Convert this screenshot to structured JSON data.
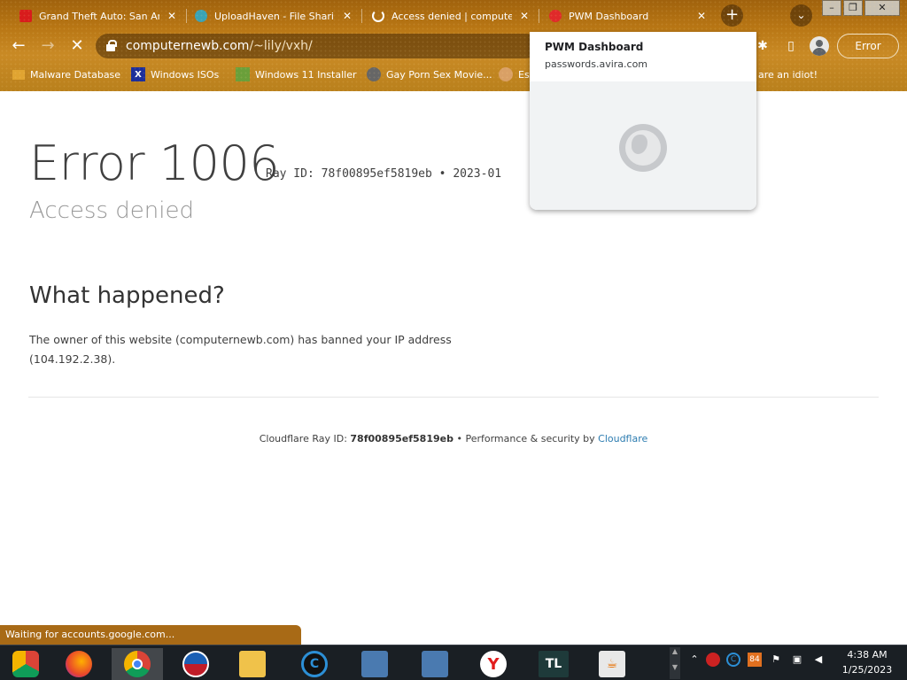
{
  "tabs": [
    {
      "title": "Grand Theft Auto: San Andreas",
      "favicon": "red-flag-icon",
      "color": "#d81c1c"
    },
    {
      "title": "UploadHaven - File Sharing",
      "favicon": "cloud-icon",
      "color": "#3aa3b5"
    },
    {
      "title": "Access denied | computernewb.com",
      "favicon": "spinner-icon",
      "color": "#ffffff"
    },
    {
      "title": "PWM Dashboard",
      "favicon": "avira-icon",
      "color": "#e02a2a"
    }
  ],
  "toolbar": {
    "url_host": "computernewb.com",
    "url_path": "/~lily/vxh/",
    "error_label": "Error"
  },
  "bookmarks": [
    {
      "label": "Malware Database",
      "icon": "folder-icon"
    },
    {
      "label": "Windows ISOs",
      "icon": "x-icon"
    },
    {
      "label": "Windows 11 Installer",
      "icon": "image-icon"
    },
    {
      "label": "Gay Porn Sex Movie...",
      "icon": "globe-icon"
    },
    {
      "label": "Es",
      "icon": "face-icon"
    },
    {
      "label": "are an idiot!",
      "icon": "page-icon"
    }
  ],
  "popup": {
    "title": "PWM Dashboard",
    "domain": "passwords.avira.com"
  },
  "page": {
    "error_code": "Error 1006",
    "ray_line": "Ray ID: 78f00895ef5819eb • 2023-01",
    "subtitle": "Access denied",
    "heading": "What happened?",
    "paragraph": "The owner of this website (computernewb.com) has banned your IP address (104.192.2.38).",
    "footer_prefix": "Cloudflare Ray ID: ",
    "footer_ray": "78f00895ef5819eb",
    "footer_mid": " • Performance & security by ",
    "footer_link": "Cloudflare"
  },
  "status": "Waiting for accounts.google.com...",
  "taskbar": {
    "apps": [
      "chrome-os-icon",
      "firefox-icon",
      "chrome-icon",
      "obama-icon",
      "explorer-icon",
      "ccleaner-icon",
      "installer-icon",
      "installer2-icon",
      "yandex-icon",
      "tl-icon",
      "java-icon"
    ],
    "tl_label": "TL",
    "time": "4:38 AM",
    "date": "1/25/2023",
    "badge": "84"
  }
}
